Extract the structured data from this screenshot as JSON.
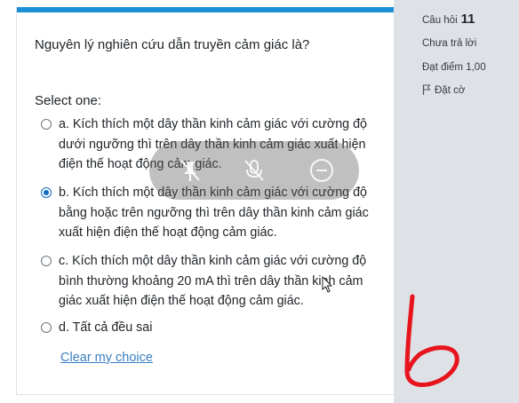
{
  "question": {
    "text": "Nguyên lý nghiên cứu dẫn truyền cảm giác là?",
    "select_label": "Select one:",
    "options": [
      {
        "label": "a. Kích thích một dây thần kinh cảm giác với cường độ dưới ngưỡng thì trên dây thần kinh cảm giác xuất hiện điện thế hoạt động cảm giác.",
        "selected": false
      },
      {
        "label": "b. Kích thích một dây thần kinh cảm giác với cường độ bằng hoặc trên ngưỡng thì trên dây thần kinh cảm giác xuất hiện điện thế hoạt động cảm giác.",
        "selected": true
      },
      {
        "label": "c. Kích thích một dây thần kinh cảm giác với cường độ bình thường khoảng 20 mA thì trên dây thần kinh cảm giác xuất hiện điện thế hoạt động cảm giác.",
        "selected": false
      },
      {
        "label": "d. Tất cả đều sai",
        "selected": false
      }
    ],
    "clear_choice": "Clear my choice"
  },
  "info": {
    "question_label": "Câu hỏi",
    "question_number": "11",
    "status": "Chưa trả lời",
    "points": "Đạt điểm 1,00",
    "flag_label": "Đặt cờ",
    "flag_icon": "flag-icon"
  },
  "overlay": {
    "icons": [
      "pin-off-icon",
      "mute-icon",
      "minus-circle-icon"
    ]
  },
  "annotation": {
    "handwritten_mark": "b",
    "color": "#e8141d"
  },
  "colors": {
    "accent_bar": "#1a8fd6",
    "link": "#3a7fc1",
    "radio_selected": "#0f6cbf",
    "info_panel": "#dee2e6"
  }
}
